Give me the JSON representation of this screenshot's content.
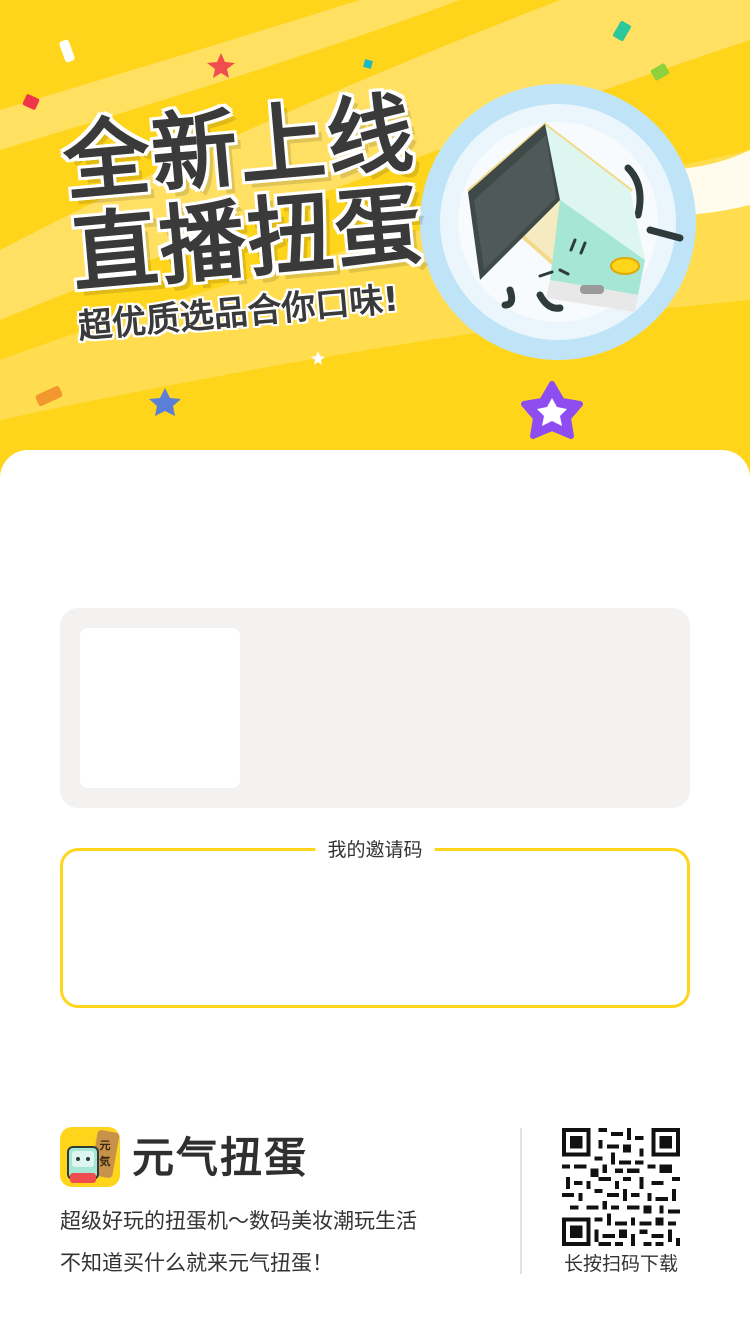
{
  "hero": {
    "headline_line1": "全新上线",
    "headline_line2": "直播扭蛋",
    "subheadline": "超优质选品合你口味!",
    "mascot_icon": "tv-box-mascot-icon",
    "colors": {
      "background": "#FFD51C",
      "text": "#3A3A3A"
    }
  },
  "invite": {
    "label": "我的邀请码",
    "border_color": "#FFD51C"
  },
  "footer": {
    "app_icon": "yuanqi-app-icon",
    "app_icon_text": "元気",
    "brand_name": "元气扭蛋",
    "slogan_line1": "超级好玩的扭蛋机～数码美妆潮玩生活",
    "slogan_line2": "不知道买什么就来元气扭蛋！",
    "qr_icon": "qr-code-icon",
    "qr_caption": "长按扫码下载"
  }
}
